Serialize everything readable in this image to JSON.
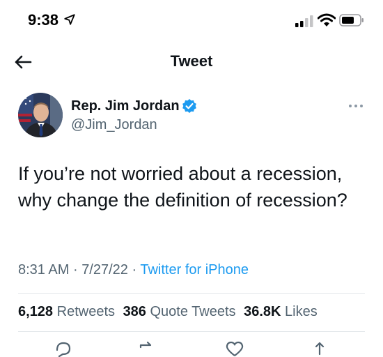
{
  "status_bar": {
    "time": "9:38",
    "icons": [
      "location-arrow-icon",
      "cellular-signal-icon",
      "wifi-icon",
      "battery-icon"
    ]
  },
  "header": {
    "title": "Tweet",
    "back_icon": "arrow-left-icon"
  },
  "tweet": {
    "author_name": "Rep. Jim Jordan",
    "author_handle": "@Jim_Jordan",
    "verified": true,
    "text": "If you’re not worried about a recession, why change the definition of recession?",
    "time": "8:31 AM",
    "date": "7/27/22",
    "separator": "·",
    "source": "Twitter for iPhone",
    "stats": {
      "retweets_count": "6,128",
      "retweets_label": "Retweets",
      "quotes_count": "386",
      "quotes_label": "Quote Tweets",
      "likes_count": "36.8K",
      "likes_label": "Likes"
    },
    "actions": [
      "reply-icon",
      "retweet-icon",
      "like-icon",
      "share-icon"
    ]
  },
  "colors": {
    "accent": "#1d9bf0",
    "text_primary": "#0f1419",
    "text_secondary": "#536471",
    "divider": "#e3e7ea"
  }
}
